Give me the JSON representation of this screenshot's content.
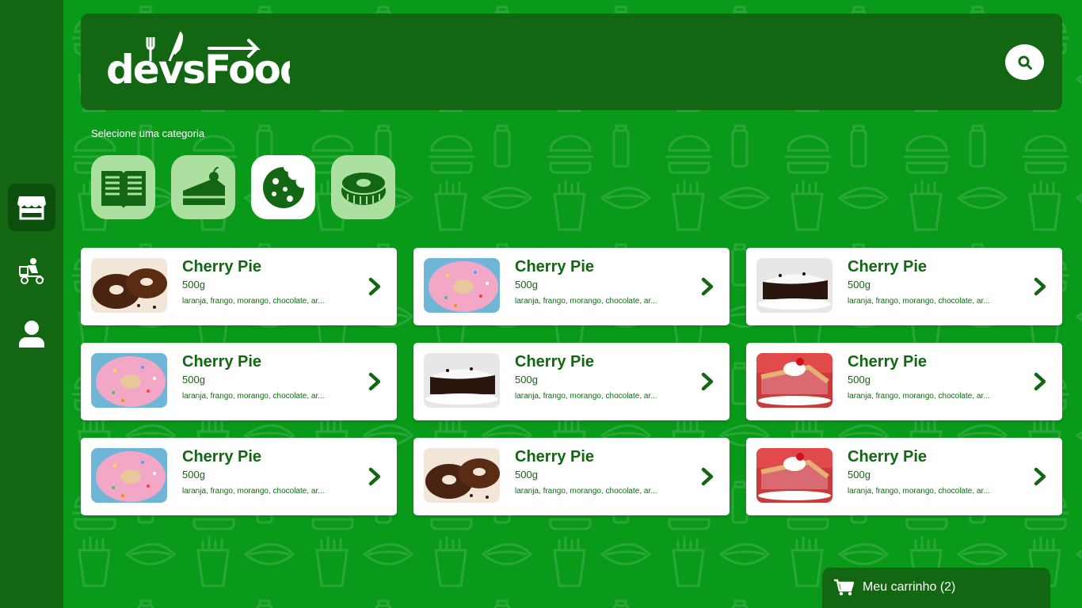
{
  "brand": {
    "logo_text": "devsFood"
  },
  "colors": {
    "dark_green": "#136713",
    "bg_green": "#0a9a1a",
    "light_green": "#abe0a1",
    "white": "#ffffff"
  },
  "sidebar": {
    "items": [
      {
        "name": "store",
        "icon": "store-icon",
        "active": true
      },
      {
        "name": "delivery",
        "icon": "delivery-icon",
        "active": false
      },
      {
        "name": "profile",
        "icon": "user-icon",
        "active": false
      }
    ]
  },
  "header": {
    "search_icon": "search-icon"
  },
  "categories": {
    "title": "Selecione uma categoria",
    "items": [
      {
        "icon": "menu-book-icon",
        "active": false
      },
      {
        "icon": "cake-icon",
        "active": false
      },
      {
        "icon": "cookie-icon",
        "active": true
      },
      {
        "icon": "donut-icon",
        "active": false
      }
    ]
  },
  "products": [
    {
      "name": "Cherry Pie",
      "weight": "500g",
      "ingredients": "laranja, frango, morango, chocolate, ar...",
      "image": "chocolate-donut"
    },
    {
      "name": "Cherry Pie",
      "weight": "500g",
      "ingredients": "laranja, frango, morango, chocolate, ar...",
      "image": "pink-donut"
    },
    {
      "name": "Cherry Pie",
      "weight": "500g",
      "ingredients": "laranja, frango, morango, chocolate, ar...",
      "image": "chocolate-pie"
    },
    {
      "name": "Cherry Pie",
      "weight": "500g",
      "ingredients": "laranja, frango, morango, chocolate, ar...",
      "image": "pink-donut"
    },
    {
      "name": "Cherry Pie",
      "weight": "500g",
      "ingredients": "laranja, frango, morango, chocolate, ar...",
      "image": "chocolate-pie"
    },
    {
      "name": "Cherry Pie",
      "weight": "500g",
      "ingredients": "laranja, frango, morango, chocolate, ar...",
      "image": "cherry-pie"
    },
    {
      "name": "Cherry Pie",
      "weight": "500g",
      "ingredients": "laranja, frango, morango, chocolate, ar...",
      "image": "pink-donut"
    },
    {
      "name": "Cherry Pie",
      "weight": "500g",
      "ingredients": "laranja, frango, morango, chocolate, ar...",
      "image": "chocolate-donut"
    },
    {
      "name": "Cherry Pie",
      "weight": "500g",
      "ingredients": "laranja, frango, morango, chocolate, ar...",
      "image": "cherry-pie"
    }
  ],
  "cart": {
    "label": "Meu carrinho (2)",
    "icon": "cart-icon"
  }
}
